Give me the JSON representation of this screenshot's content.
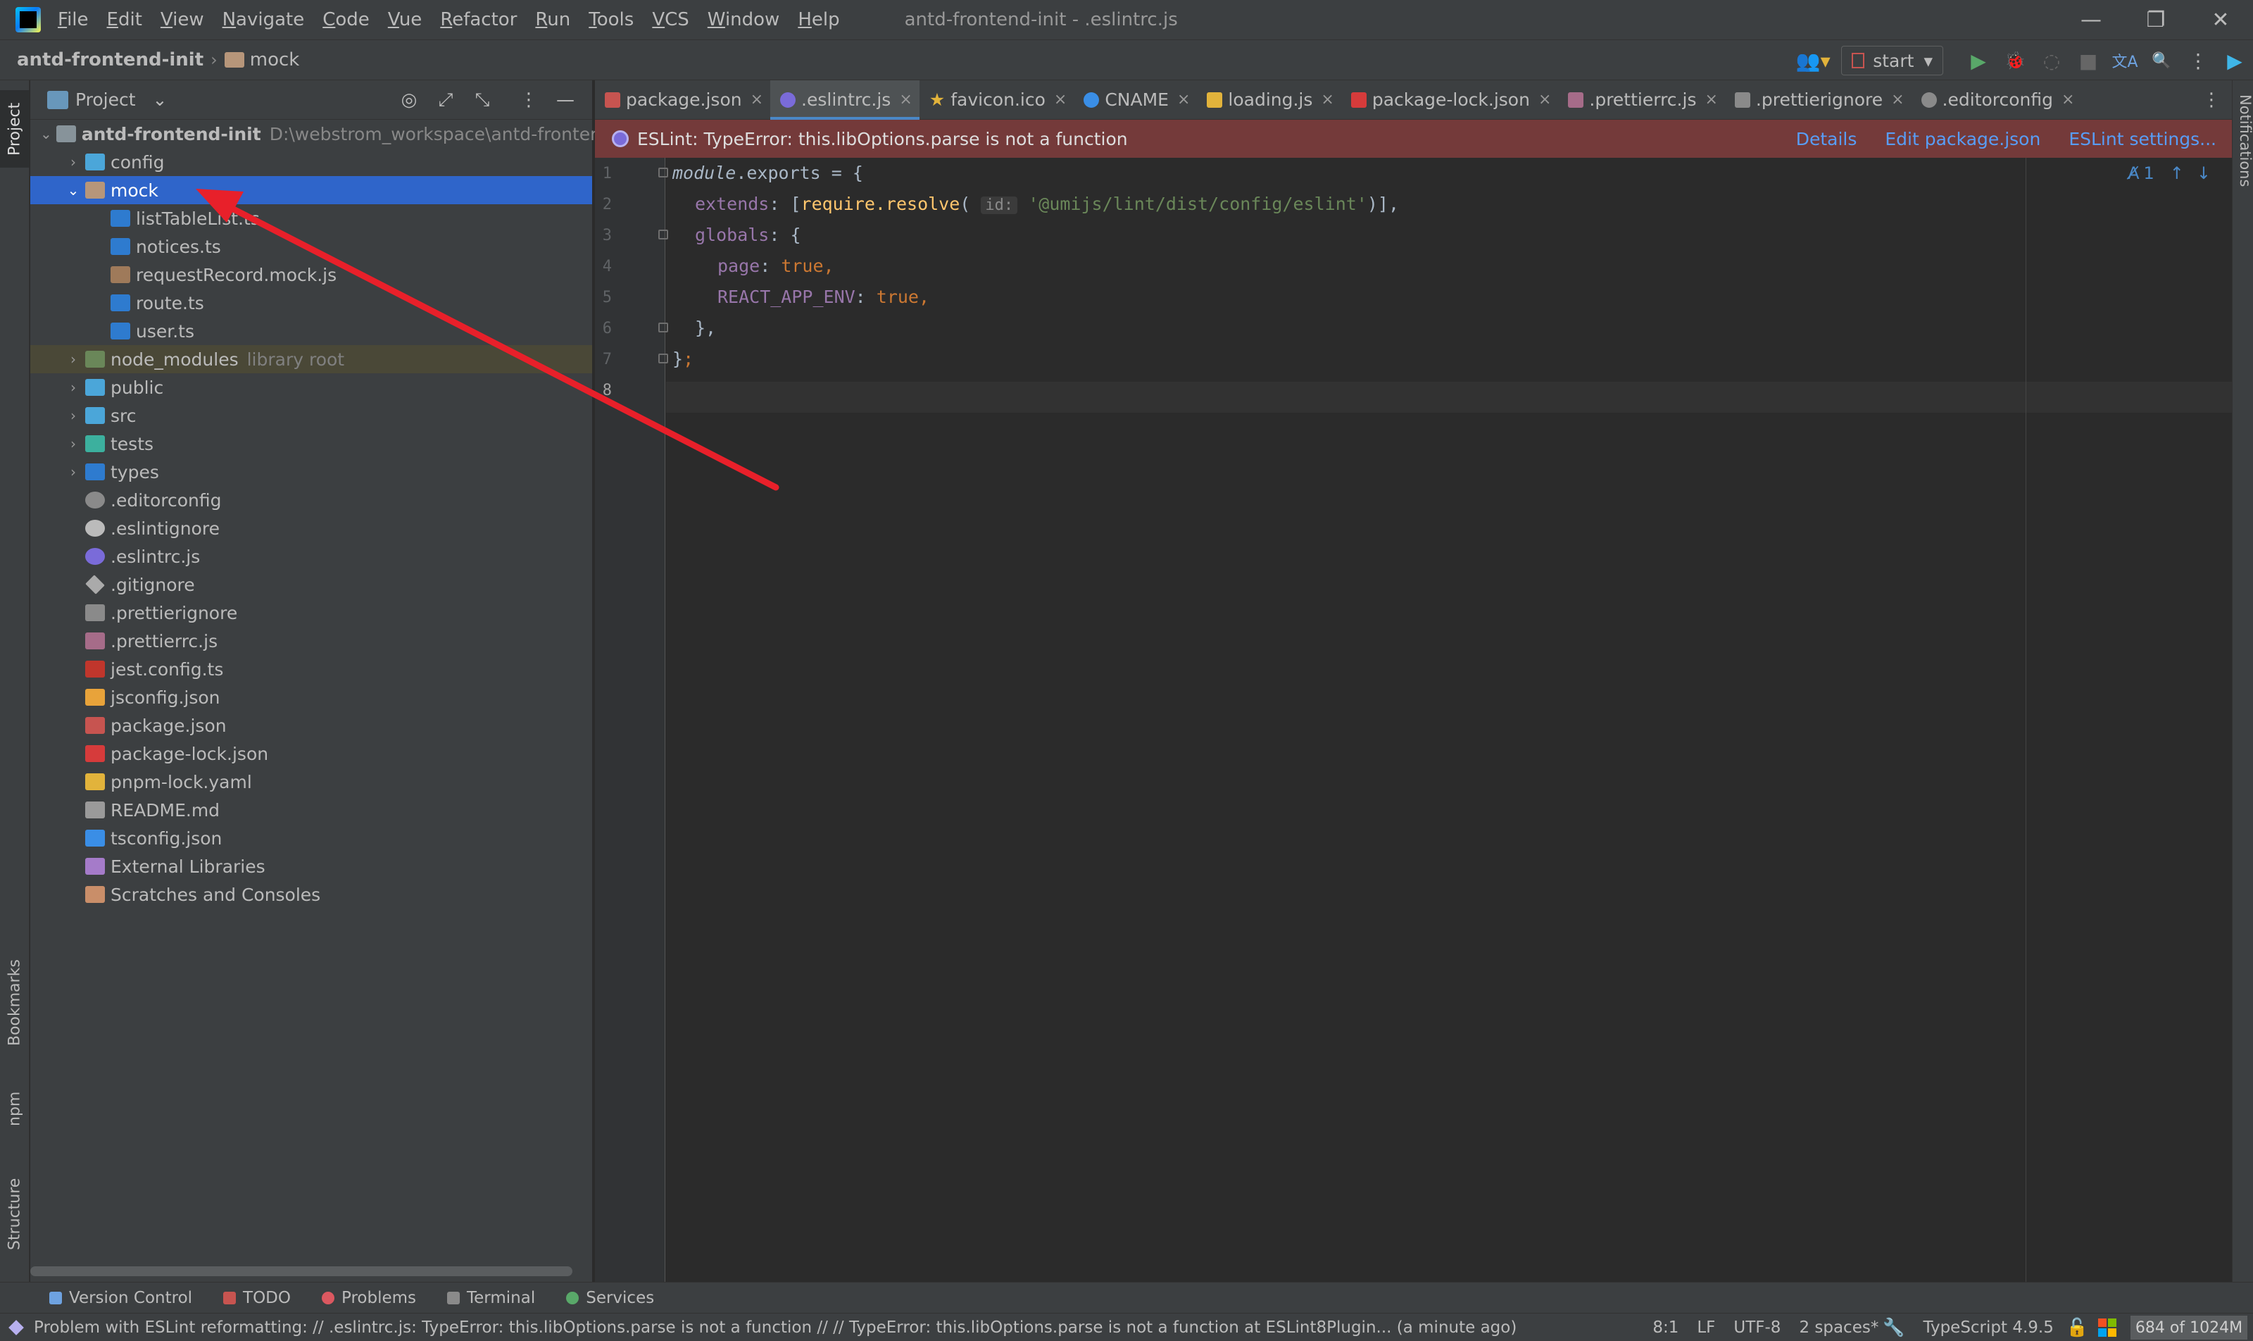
{
  "window": {
    "title": "antd-frontend-init - .eslintrc.js",
    "controls": {
      "minimize": "—",
      "restore": "❐",
      "close": "✕"
    }
  },
  "menu": [
    "File",
    "Edit",
    "View",
    "Navigate",
    "Code",
    "Vue",
    "Refactor",
    "Run",
    "Tools",
    "VCS",
    "Window",
    "Help"
  ],
  "breadcrumb": {
    "root": "antd-frontend-init",
    "sep": "›",
    "item": "mock"
  },
  "run_config": {
    "label": "start",
    "arrow": "▾"
  },
  "toolbar_icons": {
    "user": "👥▾",
    "run": "▶",
    "debug": "🐞",
    "coverage": "◌",
    "stop": "■",
    "translate": "文A",
    "search": "🔍",
    "more": "⋮",
    "ai": "▶"
  },
  "left_tabs": {
    "project": "Project",
    "bookmarks": "Bookmarks",
    "npm": "npm",
    "structure": "Structure"
  },
  "right_tabs": {
    "notifications": "Notifications"
  },
  "project_panel": {
    "title": "Project",
    "title_arrow": "⌄",
    "tools": {
      "locate": "◎",
      "expand": "⤢",
      "collapse": "⤡",
      "options": "⋮",
      "hide": "—"
    },
    "tree": [
      {
        "label": "antd-frontend-init",
        "path": "D:\\webstrom_workspace\\antd-frontend-ir",
        "icon": "folder"
      },
      {
        "label": "config",
        "icon": "folder-config"
      },
      {
        "label": "mock",
        "icon": "folder-mock"
      },
      {
        "label": "listTableList.ts",
        "icon": "ts-file"
      },
      {
        "label": "notices.ts",
        "icon": "ts-file"
      },
      {
        "label": "requestRecord.mock.js",
        "icon": "js-file"
      },
      {
        "label": "route.ts",
        "icon": "ts-file"
      },
      {
        "label": "user.ts",
        "icon": "ts-file"
      },
      {
        "label": "node_modules",
        "extra": "library root",
        "icon": "folder-node-modules"
      },
      {
        "label": "public",
        "icon": "folder"
      },
      {
        "label": "src",
        "icon": "folder"
      },
      {
        "label": "tests",
        "icon": "folder-tests"
      },
      {
        "label": "types",
        "icon": "folder"
      },
      {
        "label": ".editorconfig",
        "icon": "gear-file"
      },
      {
        "label": ".eslintignore",
        "icon": "eslint-file"
      },
      {
        "label": ".eslintrc.js",
        "icon": "eslint-file"
      },
      {
        "label": ".gitignore",
        "icon": "git-file"
      },
      {
        "label": ".prettierignore",
        "icon": "prettier-file"
      },
      {
        "label": ".prettierrc.js",
        "icon": "prettier-file"
      },
      {
        "label": "jest.config.ts",
        "icon": "jest-file"
      },
      {
        "label": "jsconfig.json",
        "icon": "jsconfig-file"
      },
      {
        "label": "package.json",
        "icon": "npm-file"
      },
      {
        "label": "package-lock.json",
        "icon": "lock-file"
      },
      {
        "label": "pnpm-lock.yaml",
        "icon": "yaml-file"
      },
      {
        "label": "README.md",
        "icon": "markdown-file"
      },
      {
        "label": "tsconfig.json",
        "icon": "tsconfig-file"
      },
      {
        "label": "External Libraries",
        "icon": "library"
      },
      {
        "label": "Scratches and Consoles",
        "icon": "scratch"
      }
    ]
  },
  "tabs": [
    {
      "label": "package.json",
      "icon": "npm-file",
      "close": "×"
    },
    {
      "label": ".eslintrc.js",
      "icon": "eslint-file",
      "close": "×",
      "active": true
    },
    {
      "label": "favicon.ico",
      "icon": "star-icon",
      "close": "×"
    },
    {
      "label": "CNAME",
      "icon": "globe-icon",
      "close": "×"
    },
    {
      "label": "loading.js",
      "icon": "js-file",
      "close": "×"
    },
    {
      "label": "package-lock.json",
      "icon": "lock-file",
      "close": "×"
    },
    {
      "label": ".prettierrc.js",
      "icon": "prettier-file",
      "close": "×"
    },
    {
      "label": ".prettierignore",
      "icon": "prettier-file",
      "close": "×"
    },
    {
      "label": ".editorconfig",
      "icon": "gear-file",
      "close": "×"
    }
  ],
  "tabs_more": "⋮",
  "error_banner": {
    "message": "ESLint: TypeError: this.libOptions.parse is not a function",
    "links": [
      "Details",
      "Edit package.json",
      "ESLint settings..."
    ]
  },
  "editor": {
    "line_numbers": [
      "1",
      "2",
      "3",
      "4",
      "5",
      "6",
      "7",
      "8"
    ],
    "hint_id": "id:",
    "code": {
      "l1_a": "module",
      "l1_b": ".exports = {",
      "l2_prop": "extends",
      "l2_b": ": [",
      "l2_fn": "require.resolve",
      "l2_c": "( ",
      "l2_str": "'@umijs/lint/dist/config/eslint'",
      "l2_d": ")],",
      "l3_prop": "globals",
      "l3_b": ": {",
      "l4_prop": "page",
      "l4_b": ": ",
      "l4_val": "true",
      "l4_c": ",",
      "l5_prop": "REACT_APP_ENV",
      "l5_b": ": ",
      "l5_val": "true",
      "l5_c": ",",
      "l6": "},",
      "l7_a": "}",
      "l7_b": ";"
    },
    "inspection": {
      "count": "1",
      "up": "↑",
      "down": "↓"
    }
  },
  "tool_windows": [
    {
      "label": "Version Control",
      "icon": "vcs-icon"
    },
    {
      "label": "TODO",
      "icon": "todo-icon"
    },
    {
      "label": "Problems",
      "icon": "problems-icon"
    },
    {
      "label": "Terminal",
      "icon": "terminal-icon"
    },
    {
      "label": "Services",
      "icon": "services-icon"
    }
  ],
  "status_bar": {
    "message": "Problem with ESLint reformatting: // .eslintrc.js: TypeError: this.libOptions.parse is not a function // // TypeError: this.libOptions.parse is not a function    at ESLint8Plugin... (a minute ago)",
    "position": "8:1",
    "line_sep": "LF",
    "encoding": "UTF-8",
    "indent": "2 spaces*",
    "language": "TypeScript 4.9.5",
    "memory": "684 of 1024M"
  },
  "colors": {
    "accent": "#2f65ca",
    "error_banner": "#743a3a",
    "link": "#589df6",
    "arrow": "#e8202a"
  }
}
